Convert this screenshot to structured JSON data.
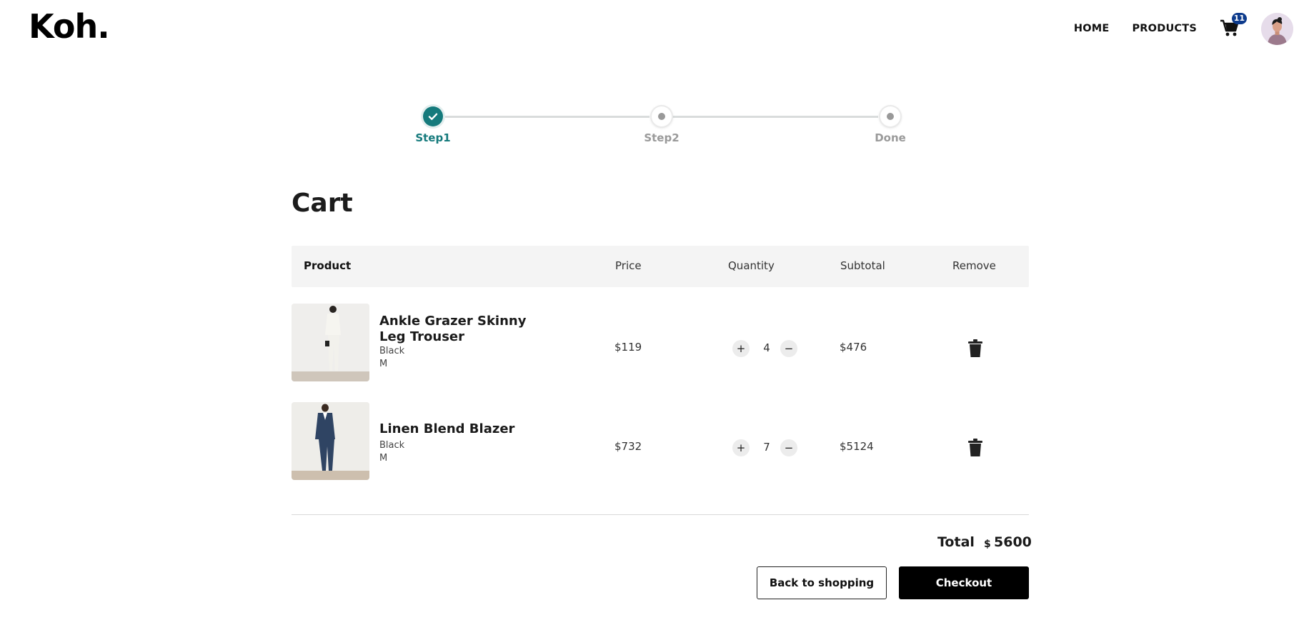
{
  "brand": {
    "logo_text": "Koh."
  },
  "nav": {
    "links": [
      {
        "label": "HOME"
      },
      {
        "label": "PRODUCTS"
      }
    ],
    "cart_count": "11",
    "cart_icon": "cart-icon",
    "avatar_icon": "user-avatar"
  },
  "stepper": {
    "steps": [
      {
        "label": "Step1",
        "state": "complete"
      },
      {
        "label": "Step2",
        "state": "pending"
      },
      {
        "label": "Done",
        "state": "pending"
      }
    ],
    "active_color": "#157a7c"
  },
  "cart": {
    "title": "Cart",
    "columns": {
      "product": "Product",
      "price": "Price",
      "quantity": "Quantity",
      "subtotal": "Subtotal",
      "remove": "Remove"
    },
    "items": [
      {
        "name": "Ankle Grazer Skinny Leg Trouser",
        "color": "Black",
        "size": "M",
        "price": "$119",
        "quantity": "4",
        "subtotal": "$476",
        "plus": "+",
        "minus": "−"
      },
      {
        "name": "Linen Blend Blazer",
        "color": "Black",
        "size": "M",
        "price": "$732",
        "quantity": "7",
        "subtotal": "$5124",
        "plus": "+",
        "minus": "−"
      }
    ],
    "total_label": "Total",
    "total_currency": "$",
    "total_value": "5600",
    "back_button": "Back to shopping",
    "checkout_button": "Checkout"
  }
}
